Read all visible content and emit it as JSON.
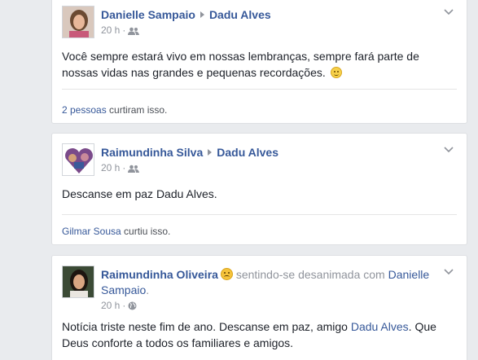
{
  "posts": [
    {
      "author": "Danielle Sampaio",
      "target": "Dadu Alves",
      "time": "20 h",
      "audience_icon": "friends-icon",
      "body": "Você sempre estará vivo em nossas lembranças, sempre fará parte de nossas vidas nas grandes e pequenas recordações.",
      "likes_link": "2 pessoas",
      "likes_text": " curtiram isso."
    },
    {
      "author": "Raimundinha Silva",
      "target": "Dadu Alves",
      "time": "20 h",
      "audience_icon": "friends-icon",
      "body": "Descanse em paz Dadu Alves.",
      "likes_link": "Gilmar Sousa",
      "likes_text": " curtiu isso."
    },
    {
      "author": "Raimundinha Oliveira",
      "feeling": " sentindo-se desanimada com ",
      "tagged": "Danielle Sampaio",
      "tagged_suffix": ".",
      "time": "20 h",
      "audience_icon": "globe-icon",
      "body_part1": "Notícia triste neste fim de ano. Descanse em paz, amigo ",
      "body_link": "Dadu Alves",
      "body_part2": ". Que Deus conforte a todos os familiares e amigos."
    }
  ]
}
